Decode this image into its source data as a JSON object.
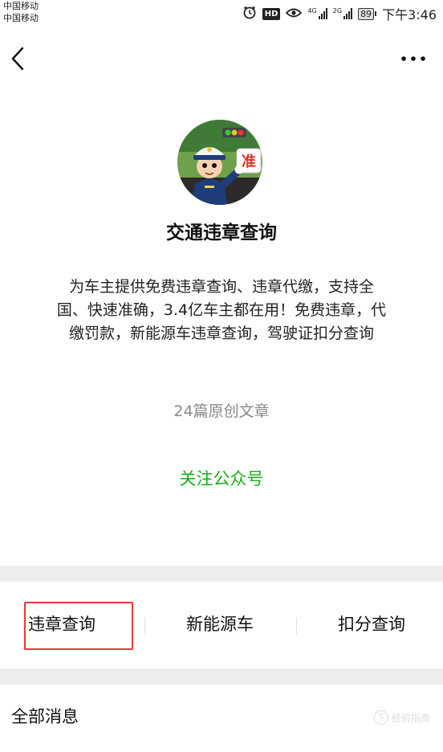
{
  "status_bar": {
    "carrier_1": "中国移动",
    "carrier_2": "中国移动",
    "hd_label": "HD",
    "network_1": "4G",
    "network_2": "2G",
    "battery": "89",
    "time": "下午3:46"
  },
  "header": {
    "back_icon": "chevron-left-icon",
    "more_icon": "more-horizontal-icon"
  },
  "profile": {
    "name": "交通违章查询",
    "description": "为车主提供免费违章查询、违章代缴，支持全国、快速准确，3.4亿车主都在用！免费违章，代缴罚款，新能源车违章查询，驾驶证扣分查询",
    "article_count": "24篇原创文章",
    "follow_label": "关注公众号",
    "avatar_sign_char": "准"
  },
  "menu": {
    "items": [
      {
        "label": "违章查询"
      },
      {
        "label": "新能源车"
      },
      {
        "label": "扣分查询"
      }
    ],
    "highlight_color": "#e33939"
  },
  "messages": {
    "label": "全部消息"
  },
  "watermark": {
    "glyph": "S",
    "text": "经验指南"
  },
  "colors": {
    "follow": "#1aad19",
    "section_gap": "#ededed"
  }
}
